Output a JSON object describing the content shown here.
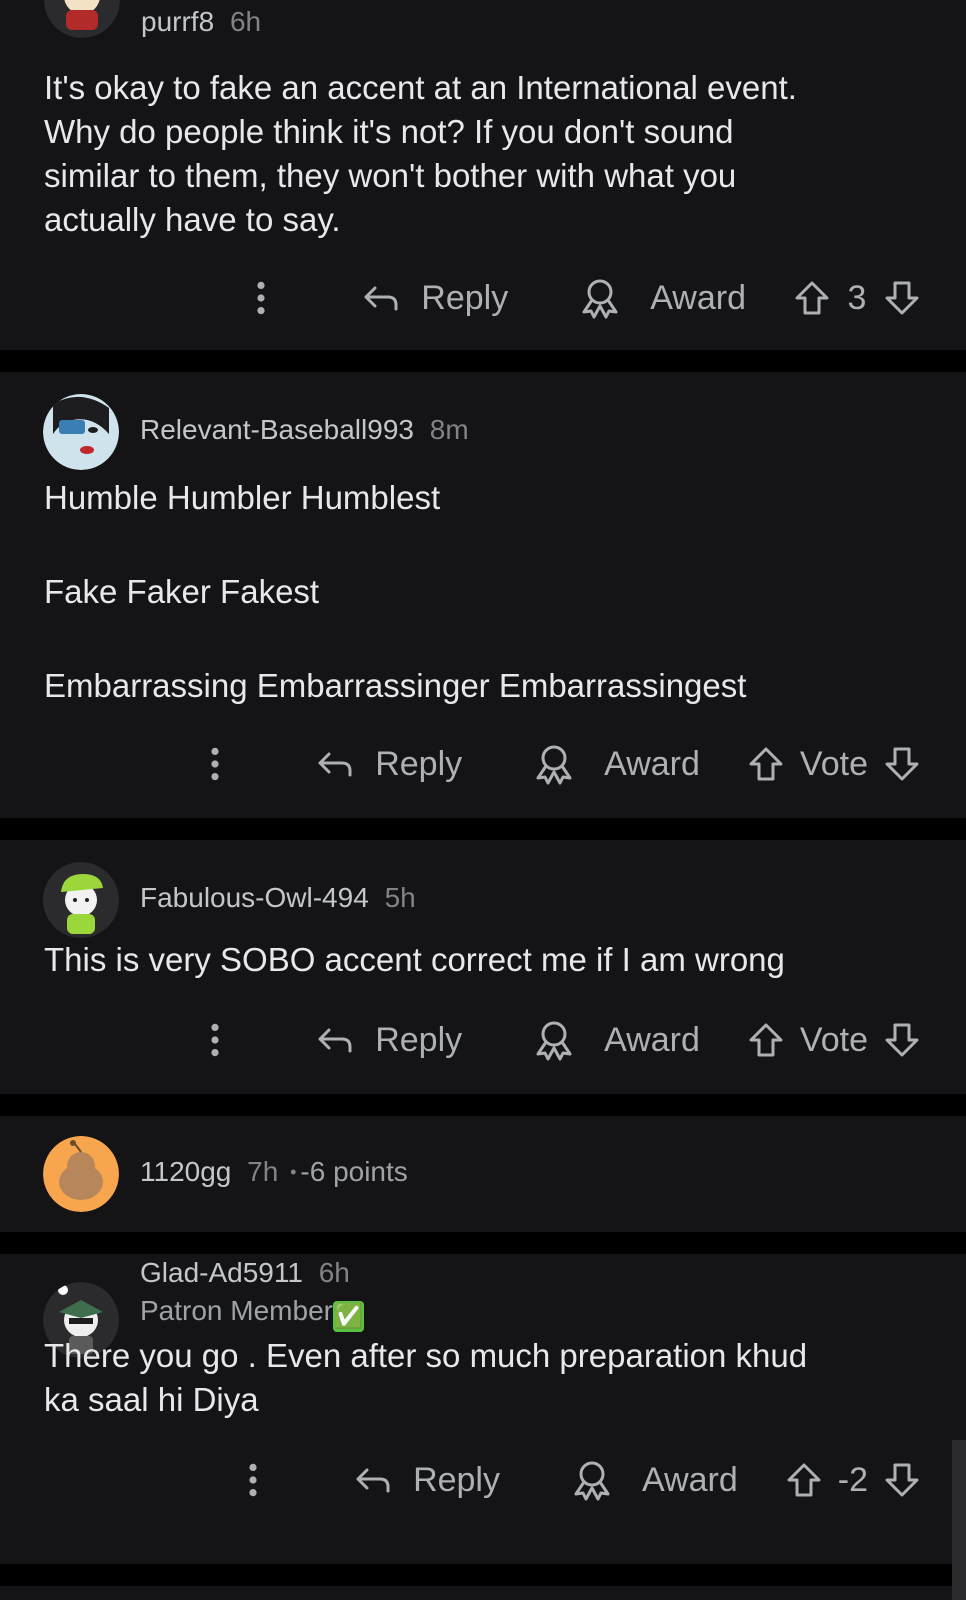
{
  "comments": [
    {
      "username": "purrf8",
      "time": "6h",
      "body": "It's okay to fake an accent at an International event.\nWhy do people think it's not? If you don't sound\nsimilar to them, they won't bother with what you\nactually have to say.",
      "reply_label": "Reply",
      "award_label": "Award",
      "score": "3"
    },
    {
      "username": "Relevant-Baseball993",
      "time": "8m",
      "body": "Humble Humbler Humblest\n\nFake Faker Fakest\n\nEmbarrassing Embarrassinger Embarrassingest",
      "reply_label": "Reply",
      "award_label": "Award",
      "score": "Vote"
    },
    {
      "username": "Fabulous-Owl-494",
      "time": "5h",
      "body": "This is very SOBO accent correct me if I am wrong",
      "reply_label": "Reply",
      "award_label": "Award",
      "score": "Vote"
    },
    {
      "username": "1120gg",
      "time": "7h",
      "separator": "•",
      "points": "-6 points"
    },
    {
      "username": "Glad-Ad5911",
      "time": "6h",
      "flair": "Patron Member",
      "flair_emoji": "✅",
      "body": "There you go . Even after so much preparation khud\nka saal hi Diya",
      "reply_label": "Reply",
      "award_label": "Award",
      "score": "-2"
    }
  ],
  "icons": {
    "more": "more-vertical-icon",
    "reply": "reply-arrow-icon",
    "award": "award-ribbon-icon",
    "upvote": "upvote-arrow-icon",
    "downvote": "downvote-arrow-icon"
  },
  "colors": {
    "background": "#000000",
    "card": "#141416",
    "text": "#e6e8ea",
    "meta": "#818384",
    "action": "#aeb1b4"
  }
}
